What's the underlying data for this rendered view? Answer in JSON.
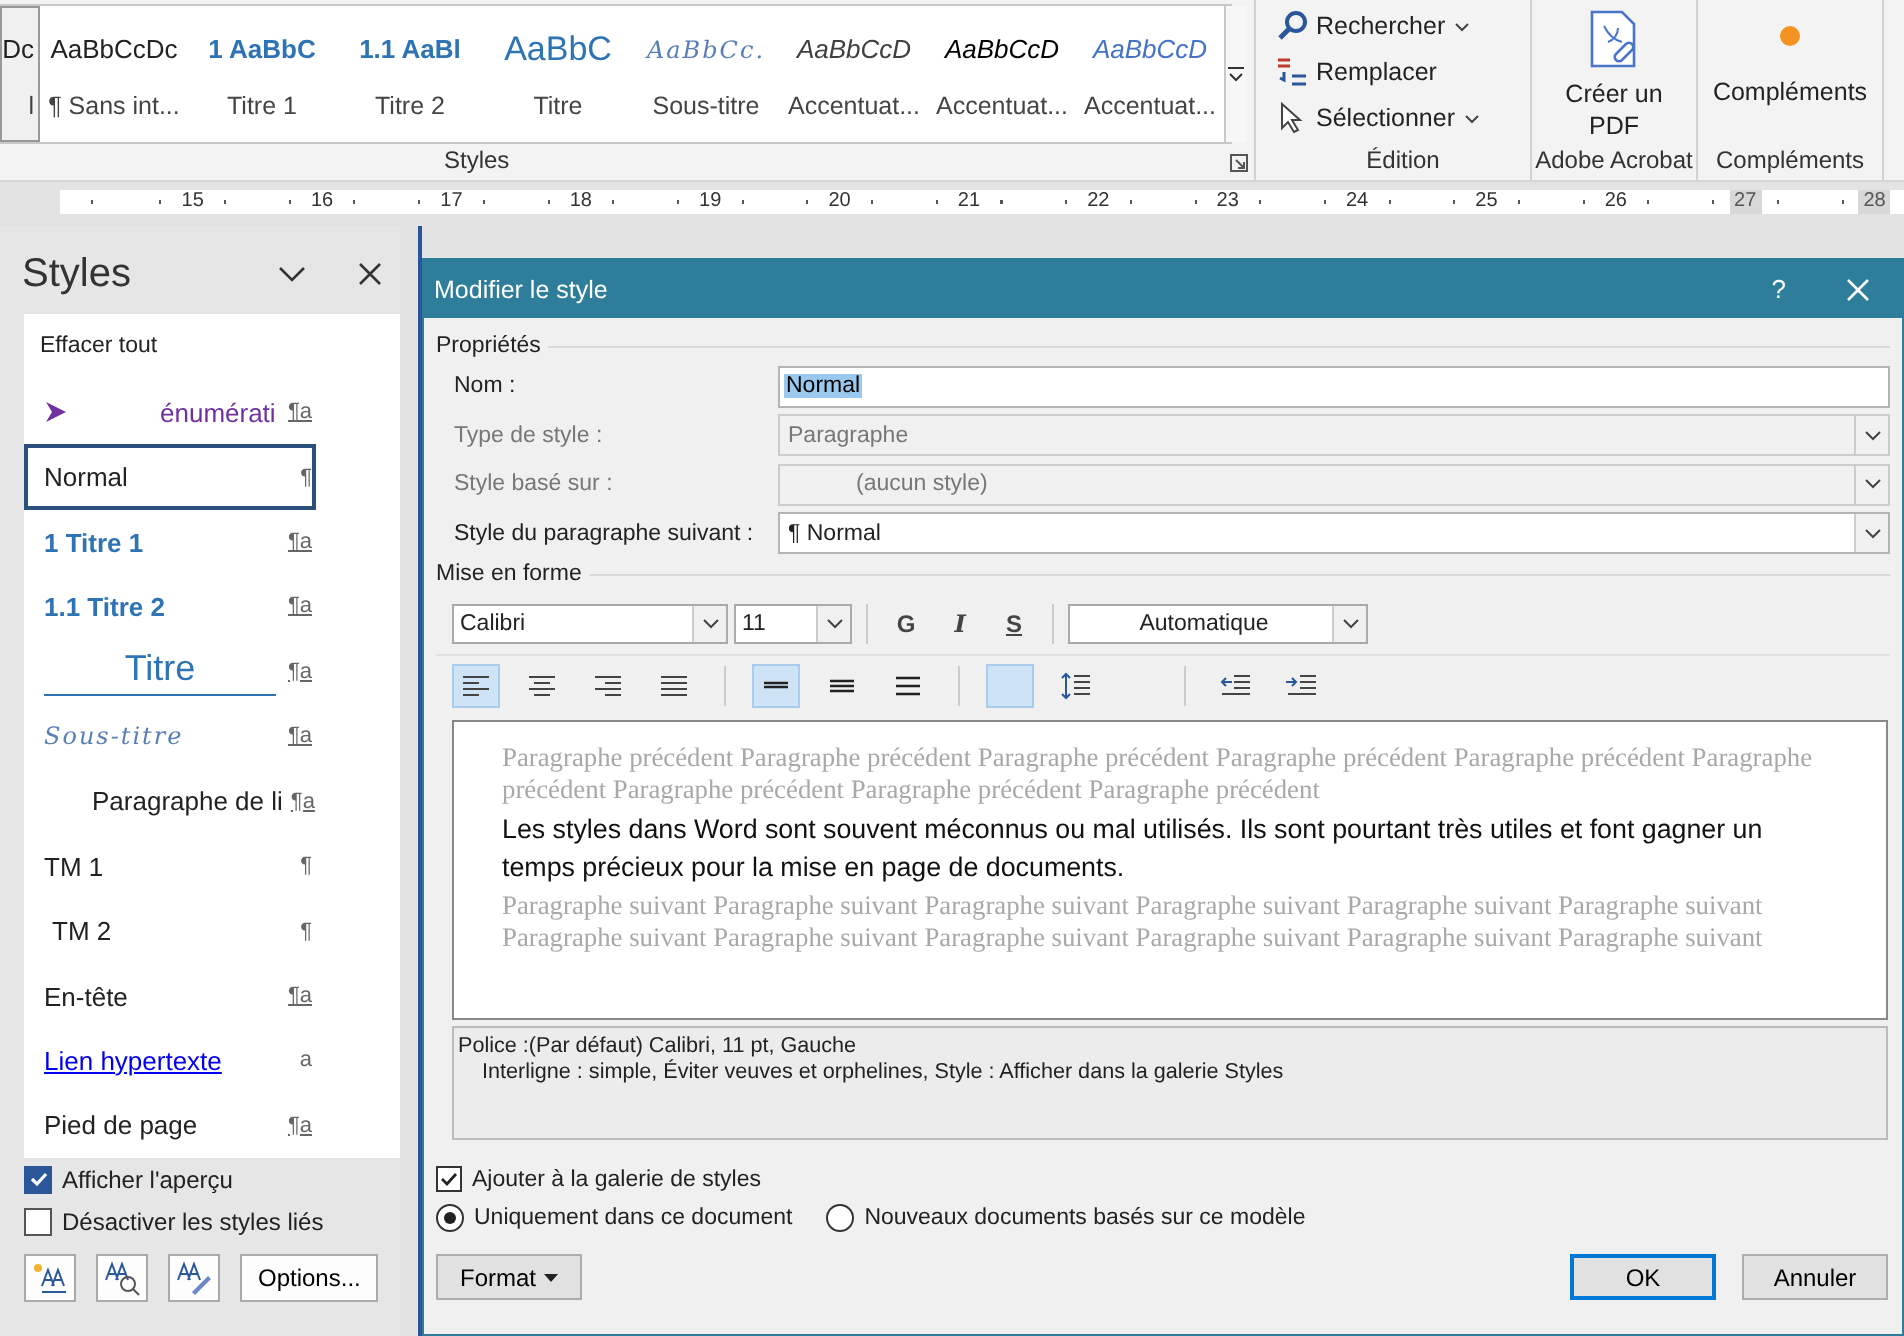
{
  "ribbon": {
    "gallery": {
      "items": [
        {
          "sample": "Dc",
          "label": "l",
          "kind": "normal",
          "selected": true
        },
        {
          "sample": "AaBbCcDc",
          "label": "¶ Sans int...",
          "kind": "normal",
          "selected": false
        },
        {
          "sample": "1  AaBbC",
          "label": "Titre 1",
          "kind": "heading1",
          "selected": false
        },
        {
          "sample": "1.1  AaBl",
          "label": "Titre 2",
          "kind": "heading2",
          "selected": false
        },
        {
          "sample": "AaBbC",
          "label": "Titre",
          "kind": "title",
          "selected": false
        },
        {
          "sample": "AaBbCc.",
          "label": "Sous-titre",
          "kind": "subtitle",
          "selected": false
        },
        {
          "sample": "AaBbCcD",
          "label": "Accentuat...",
          "kind": "subtle",
          "selected": false
        },
        {
          "sample": "AaBbCcD",
          "label": "Accentuat...",
          "kind": "emphasis",
          "selected": false
        },
        {
          "sample": "AaBbCcD",
          "label": "Accentuat...",
          "kind": "intense",
          "selected": false
        }
      ],
      "group_label": "Styles"
    },
    "edition": {
      "items": [
        {
          "label": "Rechercher",
          "kind": "find",
          "has_dropdown": true
        },
        {
          "label": "Remplacer",
          "kind": "replace",
          "has_dropdown": false
        },
        {
          "label": "Sélectionner",
          "kind": "select",
          "has_dropdown": true
        }
      ],
      "group_label": "Édition"
    },
    "acrobat": {
      "button": "Créer un PDF",
      "group_label": "Adobe Acrobat"
    },
    "addins": {
      "button": "Compléments",
      "group_label": "Compléments"
    }
  },
  "ruler": {
    "numbers": [
      "15",
      "16",
      "17",
      "18",
      "19",
      "20",
      "21",
      "22",
      "23",
      "24",
      "25",
      "26",
      "27",
      "28"
    ]
  },
  "styles_pane": {
    "title": "Styles",
    "clear_all": "Effacer tout",
    "items": [
      {
        "name": "énumérati",
        "mark": "¶a",
        "kind": "list",
        "selected": false
      },
      {
        "name": "Normal",
        "mark": "¶",
        "kind": "normal",
        "selected": true
      },
      {
        "name": "1  Titre 1",
        "mark": "¶a",
        "kind": "heading1",
        "selected": false
      },
      {
        "name": "1.1  Titre 2",
        "mark": "¶a",
        "kind": "heading2",
        "selected": false
      },
      {
        "name": "Titre",
        "mark": "¶a",
        "kind": "title",
        "selected": false
      },
      {
        "name": "Sous-titre",
        "mark": "¶a",
        "kind": "subtitle",
        "selected": false
      },
      {
        "name": "Paragraphe de li",
        "mark": "¶a",
        "kind": "list-paragraph",
        "selected": false
      },
      {
        "name": "TM 1",
        "mark": "¶",
        "kind": "normal",
        "selected": false
      },
      {
        "name": "TM 2",
        "mark": "¶",
        "kind": "toc2",
        "selected": false
      },
      {
        "name": "En-tête",
        "mark": "¶a",
        "kind": "normal",
        "selected": false
      },
      {
        "name": "Lien hypertexte",
        "mark": "a",
        "kind": "hyperlink",
        "selected": false
      },
      {
        "name": "Pied de page",
        "mark": "¶a",
        "kind": "normal",
        "selected": false
      }
    ],
    "options": [
      {
        "label": "Afficher l'aperçu",
        "checked": true
      },
      {
        "label": "Désactiver les styles liés",
        "checked": false
      }
    ],
    "options_button": "Options..."
  },
  "dialog": {
    "title": "Modifier le style",
    "help": "?",
    "properties": {
      "heading": "Propriétés",
      "fields": [
        {
          "label": "Nom :",
          "value": "Normal",
          "kind": "text",
          "disabled": false,
          "value_selected": true
        },
        {
          "label": "Type de style :",
          "value": "Paragraphe",
          "kind": "dropdown",
          "disabled": true
        },
        {
          "label": "Style basé sur :",
          "value": "(aucun style)",
          "kind": "dropdown",
          "disabled": true
        },
        {
          "label": "Style du paragraphe suivant :",
          "value": "¶  Normal",
          "kind": "dropdown",
          "disabled": false
        }
      ]
    },
    "formatting": {
      "heading": "Mise en forme",
      "font": "Calibri",
      "size": "11",
      "bold": "G",
      "italic": "I",
      "underline": "S",
      "font_color_label": "Automatique",
      "alignment": [
        {
          "kind": "left",
          "selected": true
        },
        {
          "kind": "center",
          "selected": false
        },
        {
          "kind": "right",
          "selected": false
        },
        {
          "kind": "justify",
          "selected": false
        }
      ],
      "spacing": [
        {
          "kind": "single",
          "selected": true
        },
        {
          "kind": "one-half",
          "selected": false
        },
        {
          "kind": "double",
          "selected": false
        }
      ],
      "paragraph_space": [
        {
          "kind": "blank",
          "selected": true
        },
        {
          "kind": "line-spacing",
          "selected": false
        }
      ],
      "indent": [
        {
          "kind": "decrease",
          "selected": false
        },
        {
          "kind": "increase",
          "selected": false
        }
      ]
    },
    "preview": {
      "previous": "Paragraphe précédent Paragraphe précédent Paragraphe précédent Paragraphe précédent Paragraphe précédent Paragraphe précédent Paragraphe précédent Paragraphe précédent Paragraphe précédent",
      "sample": "Les styles dans Word sont souvent méconnus ou mal utilisés. Ils sont pourtant très utiles et font gagner un temps précieux pour la mise en page de documents.",
      "following": "Paragraphe suivant Paragraphe suivant Paragraphe suivant Paragraphe suivant Paragraphe suivant Paragraphe suivant Paragraphe suivant Paragraphe suivant Paragraphe suivant Paragraphe suivant Paragraphe suivant Paragraphe suivant"
    },
    "description": [
      "Police :(Par défaut) Calibri, 11 pt, Gauche",
      "Interligne : simple, Éviter veuves et orphelines, Style : Afficher dans la galerie Styles"
    ],
    "add_to_gallery": {
      "label": "Ajouter à la galerie de styles",
      "checked": true
    },
    "scope": [
      {
        "label": "Uniquement dans ce document",
        "selected": true
      },
      {
        "label": "Nouveaux documents basés sur ce modèle",
        "selected": false
      }
    ],
    "buttons": {
      "format": "Format",
      "ok": "OK",
      "cancel": "Annuler"
    }
  }
}
